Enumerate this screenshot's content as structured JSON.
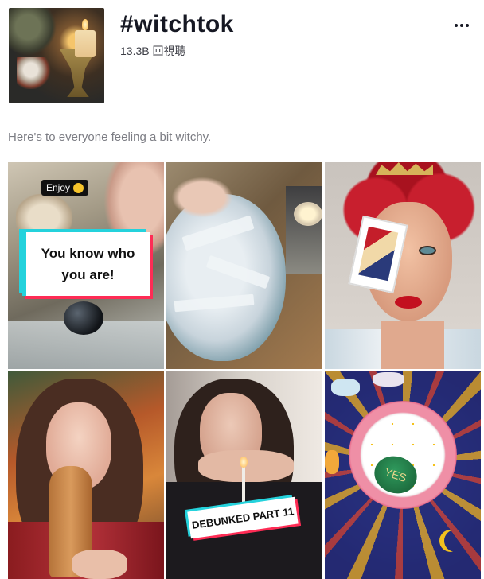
{
  "header": {
    "title": "#witchtok",
    "views": "13.3B 回視聴",
    "more_label": "..."
  },
  "description": "Here's to everyone feeling a bit witchy.",
  "videos": [
    {
      "overlay_top": "Enjoy",
      "overlay_caption": "You know who you are!"
    },
    {
      "overlay_caption": ""
    },
    {
      "overlay_caption": ""
    },
    {
      "overlay_caption": ""
    },
    {
      "overlay_caption": "DEBUNKED PART 11"
    },
    {
      "overlay_caption": "YES"
    }
  ],
  "colors": {
    "accent_cyan": "#24d2dc",
    "accent_red": "#fe2c55",
    "text_primary": "#161823",
    "text_secondary": "#7c7d84"
  },
  "icons": {
    "more": "more-horizontal-icon",
    "emoji": "grinning-face-icon"
  }
}
